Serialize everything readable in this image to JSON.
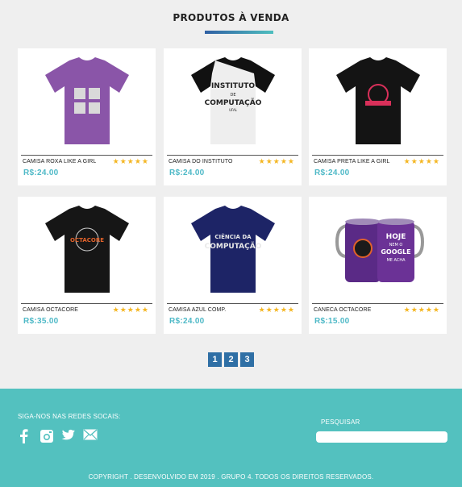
{
  "section": {
    "title": "PRODUTOS À VENDA"
  },
  "products": [
    {
      "name": "CAMISA ROXA LIKE A GIRL",
      "price": "R$:24.00",
      "rating": "★★★★★",
      "image": "purple-tshirt"
    },
    {
      "name": "CAMISA DO INSTITUTO",
      "price": "R$:24.00",
      "rating": "★★★★★",
      "image": "raglan-tshirt",
      "print_lines": [
        "INSTITUTO",
        "DE",
        "COMPUTAÇÃO",
        "UFAL"
      ]
    },
    {
      "name": "CAMISA PRETA LIKE A GIRL",
      "price": "R$:24.00",
      "rating": "★★★★★",
      "image": "black-tshirt"
    },
    {
      "name": "CAMISA OCTACORE",
      "price": "R$:35.00",
      "rating": "★★★★★",
      "image": "black-tshirt-octacore",
      "print_text": "OCTACORE"
    },
    {
      "name": "CAMISA AZUL COMP.",
      "price": "R$:24.00",
      "rating": "★★★★★",
      "image": "navy-tshirt",
      "print_lines": [
        "CIÊNCIA DA",
        "COMPUTAÇÃO"
      ]
    },
    {
      "name": "CANECA OCTACORE",
      "price": "R$:15.00",
      "rating": "★★★★★",
      "image": "purple-mugs",
      "print_lines": [
        "HOJE",
        "NEM O",
        "GOOGLE",
        "ME ACHA"
      ]
    }
  ],
  "pagination": [
    "1",
    "2",
    "3"
  ],
  "footer": {
    "follow_label": "SIGA-NOS NAS REDES SOCAIS:",
    "social_icons": [
      "facebook-icon",
      "instagram-icon",
      "twitter-icon",
      "email-icon"
    ],
    "search_label": "PESQUISAR",
    "search_value": "",
    "copyright": "COPYRIGHT . DESENVOLVIDO EM 2019 . GRUPO 4. TODOS OS DIREITOS RESERVADOS."
  },
  "colors": {
    "accent": "#53c1bf",
    "price": "#4fb9c7",
    "star": "#f4b623",
    "pager": "#2f6fa5"
  }
}
